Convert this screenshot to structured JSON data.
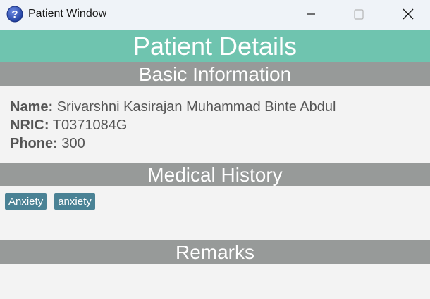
{
  "window": {
    "title": "Patient Window",
    "icon": "help-question-icon",
    "controls": [
      "minimize-icon",
      "maximize-icon",
      "close-icon"
    ]
  },
  "header": {
    "title": "Patient Details"
  },
  "basic_info": {
    "heading": "Basic Information",
    "name_label": "Name:",
    "name_value": "Srivarshni Kasirajan Muhammad Binte Abdul",
    "nric_label": "NRIC:",
    "nric_value": "T0371084G",
    "phone_label": "Phone:",
    "phone_value": "300"
  },
  "medical_history": {
    "heading": "Medical History",
    "tags": [
      "Anxiety",
      "anxiety"
    ]
  },
  "remarks": {
    "heading": "Remarks"
  },
  "colors": {
    "header": "#6fc4af",
    "section": "#979a99",
    "tag": "#4a8295",
    "background": "#f3f3f3"
  }
}
